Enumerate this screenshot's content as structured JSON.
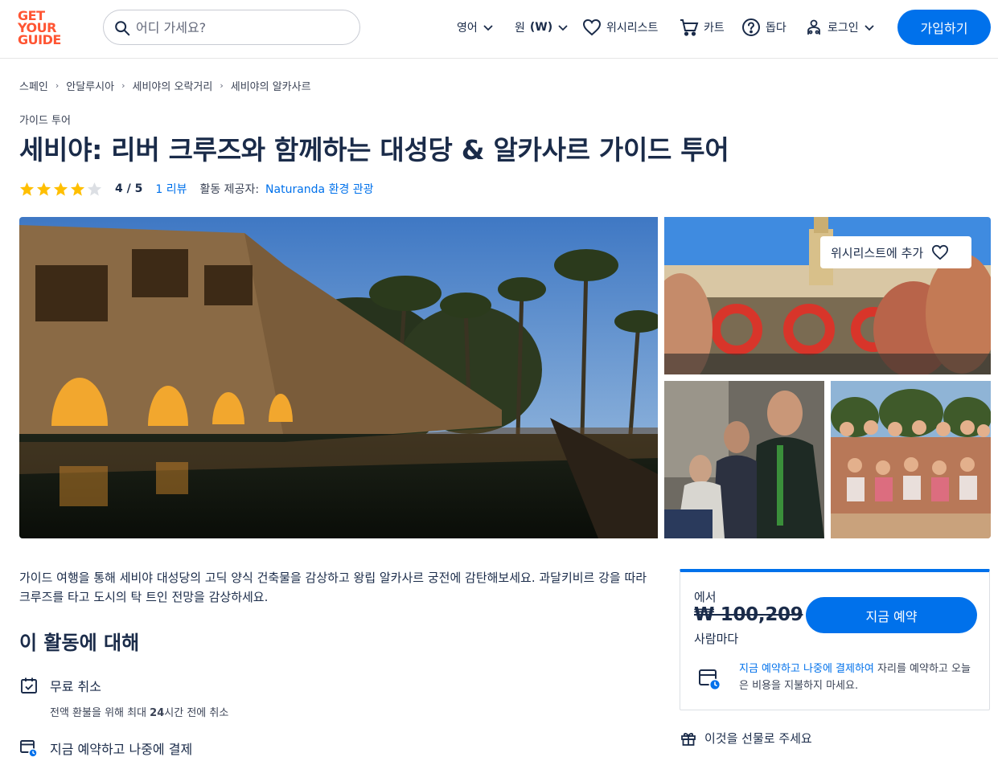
{
  "header": {
    "logo_lines": [
      "GET",
      "YOUR",
      "GUIDE"
    ],
    "search_placeholder": "어디 가세요?",
    "language": "영어",
    "currency_label": "원",
    "currency_code": "(W)",
    "wishlist": "위시리스트",
    "cart": "카트",
    "help": "돕다",
    "login": "로그인",
    "signup": "가입하기"
  },
  "breadcrumb": [
    "스페인",
    "안달루시아",
    "세비야의 오락거리",
    "세비야의 알카사르"
  ],
  "activity": {
    "category": "가이드 투어",
    "title": "세비야: 리버 크루즈와 함께하는 대성당 & 알카사르 가이드 투어",
    "rating_stars": 4,
    "rating_text": "4 / 5",
    "reviews": "1 리뷰",
    "provider_label": "활동 제공자:",
    "provider_name": "Naturanda 환경 관광"
  },
  "gallery": {
    "wishlist_add": "위시리스트에 추가"
  },
  "description": "가이드 여행을 통해 세비야 대성당의 고딕 양식 건축물을 감상하고 왕립 알카사르 궁전에 감탄해보세요. 과달키비르 강을 따라 크루즈를 타고 도시의 탁 트인 전망을 감상하세요.",
  "about": {
    "title": "이 활동에 대해",
    "features": [
      {
        "title": "무료 취소",
        "sub_before": "전액 환불을 위해 최대 ",
        "sub_bold": "24",
        "sub_after": "시간 전에 취소"
      },
      {
        "title": "지금 예약하고 나중에 결제"
      }
    ]
  },
  "booking": {
    "from": "에서",
    "price": "₩ 100,209",
    "per": "사람마다",
    "book_now": "지금 예약",
    "note_link": "지금 예약하고 나중에 결제하여",
    "note_rest": " 자리를 예약하고 오늘은 비용을 지불하지 마세요."
  },
  "gift": "이것을 선물로 주세요",
  "colors": {
    "brand": "#ff5533",
    "accent": "#0071eb",
    "star": "#ffbf00",
    "text": "#1a2b49"
  }
}
